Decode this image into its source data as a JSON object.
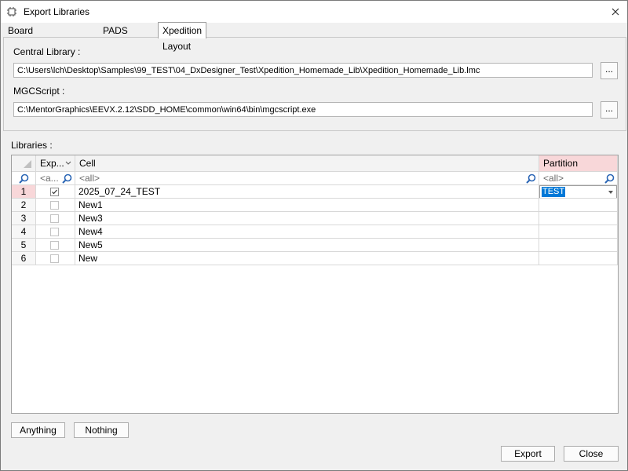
{
  "window": {
    "title": "Export Libraries"
  },
  "tabs": [
    {
      "label": "Board Station Layout",
      "active": false
    },
    {
      "label": "PADS Layout",
      "active": false
    },
    {
      "label": "Xpedition Layout",
      "active": true
    }
  ],
  "central_library": {
    "label": "Central Library :",
    "value": "C:\\Users\\lch\\Desktop\\Samples\\99_TEST\\04_DxDesigner_Test\\Xpedition_Homemade_Lib\\Xpedition_Homemade_Lib.lmc",
    "browse_label": "..."
  },
  "mgcscript": {
    "label": "MGCScript :",
    "value": "C:\\MentorGraphics\\EEVX.2.12\\SDD_HOME\\common\\win64\\bin\\mgcscript.exe",
    "browse_label": "..."
  },
  "libraries": {
    "label": "Libraries :",
    "columns": {
      "export": "Exp...",
      "cell": "Cell",
      "partition": "Partition"
    },
    "filters": {
      "export": "<a...",
      "cell": "<all>",
      "partition": "<all>"
    },
    "rows": [
      {
        "num": "1",
        "checked": true,
        "cell": "2025_07_24_TEST",
        "partition": "TEST",
        "selected": true
      },
      {
        "num": "2",
        "checked": false,
        "cell": "New1",
        "partition": ""
      },
      {
        "num": "3",
        "checked": false,
        "cell": "New3",
        "partition": ""
      },
      {
        "num": "4",
        "checked": false,
        "cell": "New4",
        "partition": ""
      },
      {
        "num": "5",
        "checked": false,
        "cell": "New5",
        "partition": ""
      },
      {
        "num": "6",
        "checked": false,
        "cell": "New",
        "partition": ""
      }
    ]
  },
  "buttons": {
    "anything": "Anything",
    "nothing": "Nothing",
    "export": "Export",
    "close": "Close"
  },
  "colors": {
    "selection": "#0078d7",
    "row_selected": "#f8d7d9",
    "partition_header": "#f8d7d9"
  }
}
